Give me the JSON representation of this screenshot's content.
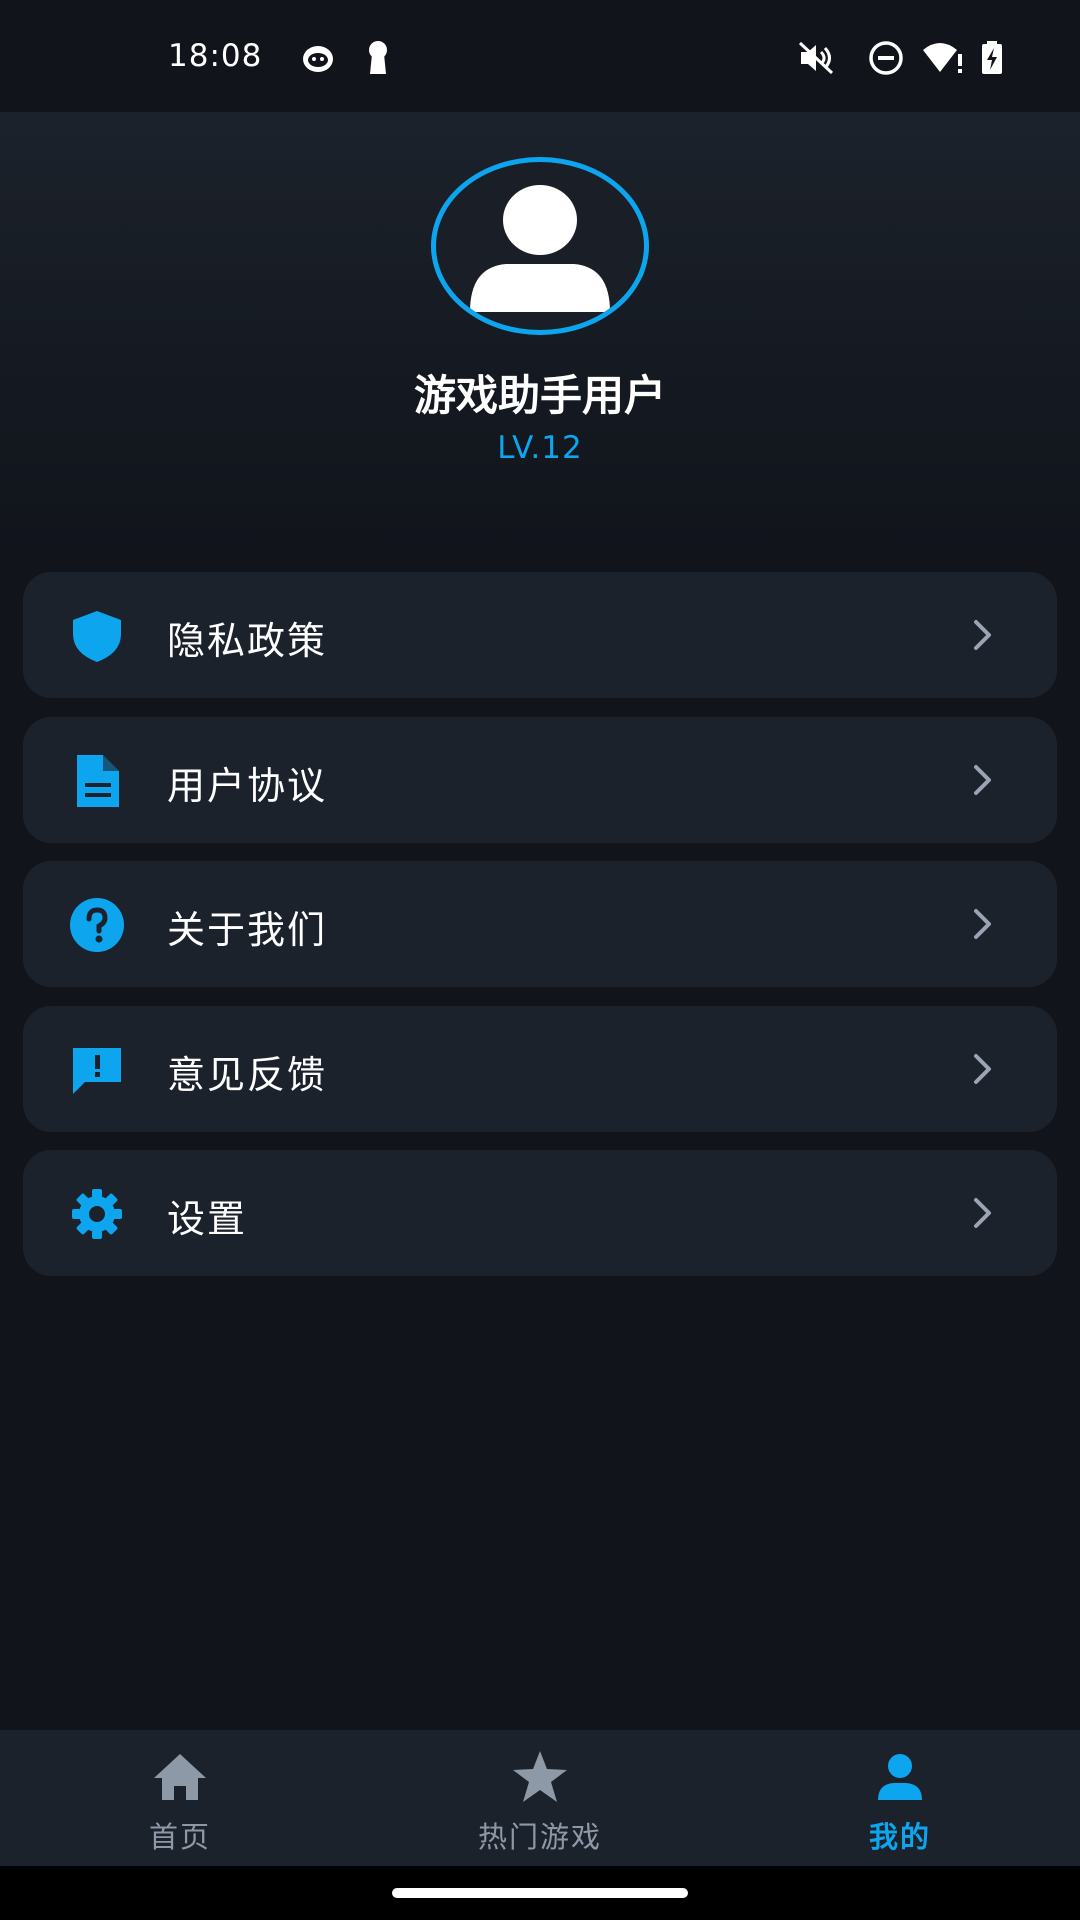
{
  "status_bar": {
    "time": "18:08",
    "left_icons": [
      "notification-app-icon",
      "keyhole-icon"
    ],
    "right_icons": [
      "mute-icon",
      "do-not-disturb-icon",
      "wifi-alert-icon",
      "battery-charging-icon"
    ]
  },
  "profile": {
    "name": "游戏助手用户",
    "level": "LV.12",
    "avatar_icon": "person-icon"
  },
  "menu": {
    "items": [
      {
        "label": "隐私政策",
        "icon": "shield-icon"
      },
      {
        "label": "用户协议",
        "icon": "document-icon"
      },
      {
        "label": "关于我们",
        "icon": "help-circle-icon"
      },
      {
        "label": "意见反馈",
        "icon": "feedback-icon"
      },
      {
        "label": "设置",
        "icon": "gear-icon"
      }
    ]
  },
  "bottom_nav": {
    "items": [
      {
        "label": "首页",
        "icon": "home-icon",
        "active": false
      },
      {
        "label": "热门游戏",
        "icon": "star-icon",
        "active": false
      },
      {
        "label": "我的",
        "icon": "person-icon",
        "active": true
      }
    ]
  },
  "colors": {
    "accent": "#0ea5ef",
    "background": "#11141b",
    "card": "#1c222b",
    "inactive": "#8e99a8",
    "chevron": "#9aa4b4"
  }
}
